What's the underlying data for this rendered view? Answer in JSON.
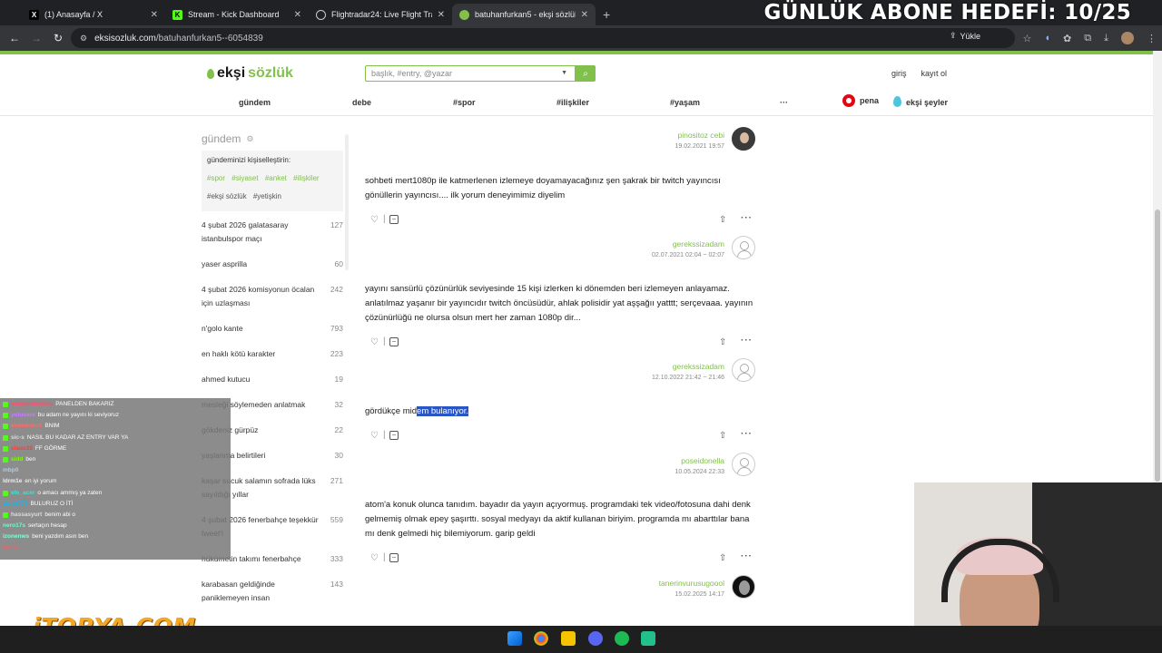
{
  "browser": {
    "tabs": [
      {
        "title": "(1) Anasayfa / X",
        "icon": "x-logo-icon",
        "active": false
      },
      {
        "title": "Stream - Kick Dashboard",
        "icon": "kick-logo-icon",
        "active": false
      },
      {
        "title": "Flightradar24: Live Flight Tracke",
        "icon": "globe-icon",
        "active": false
      },
      {
        "title": "batuhanfurkan5 - ekşi sözlük",
        "icon": "eksi-drop-icon",
        "active": true
      }
    ],
    "address": {
      "host": "eksisozluk.com",
      "path": "/batuhanfurkan5--6054839"
    },
    "upload_label": "Yükle"
  },
  "overlay": {
    "goal_text": "GÜNLÜK ABONE HEDEFİ: 10/25",
    "sponsor": "iTOPYA.COM"
  },
  "site": {
    "logo_prefix": "ekşi",
    "logo_suffix": "sözlük",
    "search_placeholder": "başlık, #entry, @yazar",
    "login": "giriş",
    "register": "kayıt ol",
    "nav": [
      "gündem",
      "debe",
      "#spor",
      "#ilişkiler",
      "#yaşam",
      "···"
    ],
    "pena": "pena",
    "eksi_seyler": "ekşi şeyler",
    "colors": {
      "brand": "#81c14b",
      "highlight": "#2a55c5"
    }
  },
  "sidebar": {
    "title": "gündem",
    "personalize_label": "gündeminizi kişiselleştirin:",
    "tags": [
      "#spor",
      "#siyaset",
      "#anket",
      "#ilişkiler",
      "#ekşi sözlük",
      "#yetişkin"
    ],
    "topics": [
      {
        "title": "4 şubat 2026 galatasaray istanbulspor maçı",
        "count": "127"
      },
      {
        "title": "yaser asprilla",
        "count": "60"
      },
      {
        "title": "4 şubat 2026 komisyonun öcalan için uzlaşması",
        "count": "242"
      },
      {
        "title": "n'golo kante",
        "count": "793"
      },
      {
        "title": "en haklı kötü karakter",
        "count": "223"
      },
      {
        "title": "ahmed kutucu",
        "count": "19"
      },
      {
        "title": "mesleği söylemeden anlatmak",
        "count": "32"
      },
      {
        "title": "gökdeniz gürpüz",
        "count": "22"
      },
      {
        "title": "yaşlanma belirtileri",
        "count": "30"
      },
      {
        "title": "kaşar sucuk salamın sofrada lüks sayıldığı yıllar",
        "count": "271"
      },
      {
        "title": "4 şubat 2026 fenerbahçe teşekkür tweet'i",
        "count": "559"
      },
      {
        "title": "hükümetin takımı fenerbahçe",
        "count": "333"
      },
      {
        "title": "karabasan geldiğinde paniklemeyen insan",
        "count": "143"
      }
    ]
  },
  "entries": [
    {
      "author": "pinositoz cebi",
      "date": "19.02.2021 19:57",
      "text": "",
      "avatar": "photo"
    },
    {
      "author": "gerekssizadam",
      "date": "02.07.2021 02:04 ~ 02:07",
      "text": "sohbeti mert1080p ile katmerlenen izlemeye doyamayacağınız şen şakrak bir twitch yayıncısı gönüllerin yayıncısı.... ilk yorum deneyimimiz diyelim",
      "avatar": "blank"
    },
    {
      "author": "gerekssizadam",
      "date": "12.10.2022 21:42 ~ 21:46",
      "text": "yayını sansürlü çözünürlük seviyesinde 15 kişi izlerken ki dönemden beri izlemeyen anlayamaz. anlatılmaz yaşanır bir yayıncıdır twitch öncüsüdür, ahlak polisidir yat aşşağıı yatttt; serçevaaa. yayının çözünürlüğü ne olursa olsun mert her zaman 1080p dir...",
      "avatar": "blank"
    },
    {
      "author": "poseidonella",
      "date": "10.05.2024 22:33",
      "text_plain": "gördükçe mid",
      "text_selected": "em bulanıyor.",
      "avatar": "blank"
    },
    {
      "author": "tanerinvurusugoool",
      "date": "15.02.2025 14:17",
      "text": "atom'a konuk olunca tanıdım. bayadır da yayın açıyormuş. programdaki tek video/fotosuna dahi denk gelmemiş olmak epey şaşırttı. sosyal medyayı da aktif kullanan biriyim. programda mı abarttılar bana mı denk gelmedi hiç bilemiyorum. garip geldi",
      "avatar": "dark"
    }
  ],
  "chat": [
    {
      "user": "vampiromithas",
      "msg": "PANELDEN BAKARIZ"
    },
    {
      "user": "yoluvare",
      "msg": "bu adam ne yayını ki seviyoruz"
    },
    {
      "user": "eremenko1",
      "msg": "BNIM"
    },
    {
      "user": "sic-s",
      "msg": "NASIL BU KADAR AZ ENTRY VAR YA"
    },
    {
      "user": "slaus33",
      "msg": "FF GÖRME"
    },
    {
      "user": "sidd",
      "msg": "ben"
    },
    {
      "user": "mbp0",
      "msg": ""
    },
    {
      "user": "ldrm1e",
      "msg": "en iyi yorum"
    },
    {
      "user": "efe_acer",
      "msg": "o amacı ammış ya zaten"
    },
    {
      "user": "dalec777",
      "msg": "BULURUZ O İTİ"
    },
    {
      "user": "hassasyurt",
      "msg": "benim abi o"
    },
    {
      "user": "nero17s",
      "msg": "sertaçın hesap"
    },
    {
      "user": "izonenws",
      "msg": "beni yazdım asın ben"
    },
    {
      "user": "bahet",
      "msg": ""
    }
  ]
}
